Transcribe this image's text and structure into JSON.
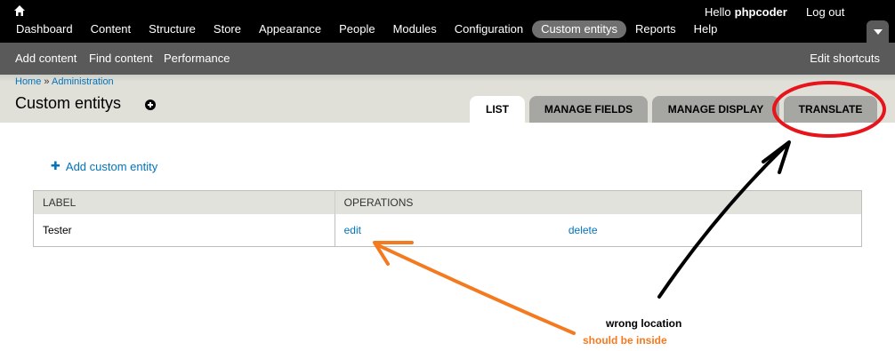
{
  "toolbar": {
    "home_icon": "home-icon",
    "greeting": "Hello",
    "username": "phpcoder",
    "logout": "Log out",
    "menu": [
      {
        "label": "Dashboard"
      },
      {
        "label": "Content"
      },
      {
        "label": "Structure"
      },
      {
        "label": "Store"
      },
      {
        "label": "Appearance"
      },
      {
        "label": "People"
      },
      {
        "label": "Modules"
      },
      {
        "label": "Configuration"
      },
      {
        "label": "Custom entitys",
        "active": true
      },
      {
        "label": "Reports"
      },
      {
        "label": "Help"
      }
    ]
  },
  "shortcuts": {
    "items": [
      {
        "label": "Add content"
      },
      {
        "label": "Find content"
      },
      {
        "label": "Performance"
      }
    ],
    "edit": "Edit shortcuts"
  },
  "breadcrumb": {
    "home": "Home",
    "separator": "»",
    "admin": "Administration"
  },
  "page": {
    "title": "Custom entitys"
  },
  "tabs": [
    {
      "label": "List",
      "active": true
    },
    {
      "label": "Manage fields"
    },
    {
      "label": "Manage display"
    },
    {
      "label": "Translate"
    }
  ],
  "actions": {
    "add_label": "Add custom entity",
    "add_icon": "plus-icon"
  },
  "table": {
    "headers": [
      "LABEL",
      "OPERATIONS"
    ],
    "rows": [
      {
        "label": "Tester",
        "edit": "edit",
        "delete": "delete"
      }
    ]
  },
  "annotations": {
    "black_note": "wrong location",
    "orange_note": "should be inside",
    "orange_color": "#f47a20",
    "red_color": "#e8141c"
  }
}
